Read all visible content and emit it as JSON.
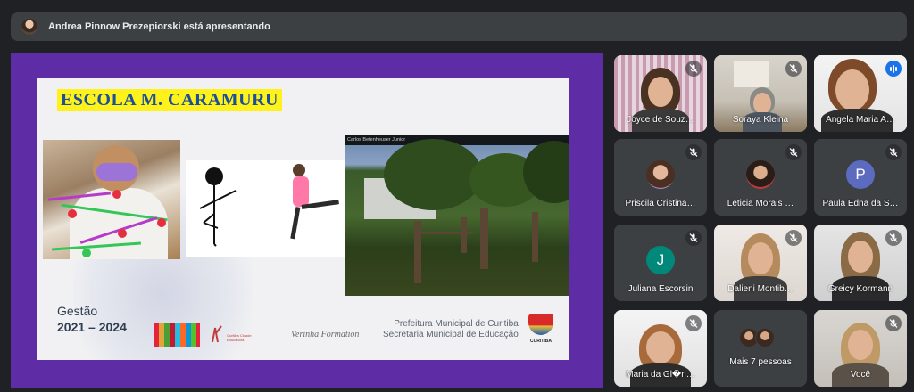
{
  "presenter_bar": {
    "text": "Andrea Pinnow Prezepiorski está apresentando"
  },
  "slide": {
    "title": "ESCOLA M. CARAMURU",
    "park_photo_label": "Carlos Betenheuser Junior",
    "gestao_label": "Gestão",
    "gestao_years": "2021 – 2024",
    "logo_text": "Curitiba Cidade Educadora",
    "signature": "Verinha Formation",
    "prefeitura_line1": "Prefeitura Municipal de Curitiba",
    "prefeitura_line2": "Secretaria Municipal de Educação",
    "crest_label": "CURITIBA"
  },
  "participants": [
    {
      "name": "Joyce de Souz…",
      "type": "video",
      "muted": true
    },
    {
      "name": "Soraya Kleina",
      "type": "video",
      "muted": true
    },
    {
      "name": "Angela Maria A…",
      "type": "video",
      "speaking": true
    },
    {
      "name": "Priscila Cristina…",
      "type": "avatar",
      "muted": true
    },
    {
      "name": "Leticia Morais …",
      "type": "avatar",
      "muted": true
    },
    {
      "name": "Paula Edna da S…",
      "type": "initial",
      "initial": "P",
      "color": "#5c6bc0",
      "muted": true
    },
    {
      "name": "Juliana Escorsin",
      "type": "initial",
      "initial": "J",
      "color": "#00897b",
      "muted": true
    },
    {
      "name": "Dalieni Montib…",
      "type": "video",
      "muted": true
    },
    {
      "name": "Greicy Kormann",
      "type": "video",
      "muted": true
    },
    {
      "name": "Maria da Gl�ri…",
      "type": "video",
      "muted": true
    },
    {
      "name": "Mais 7 pessoas",
      "type": "more"
    },
    {
      "name": "Você",
      "type": "video",
      "muted": true
    }
  ]
}
